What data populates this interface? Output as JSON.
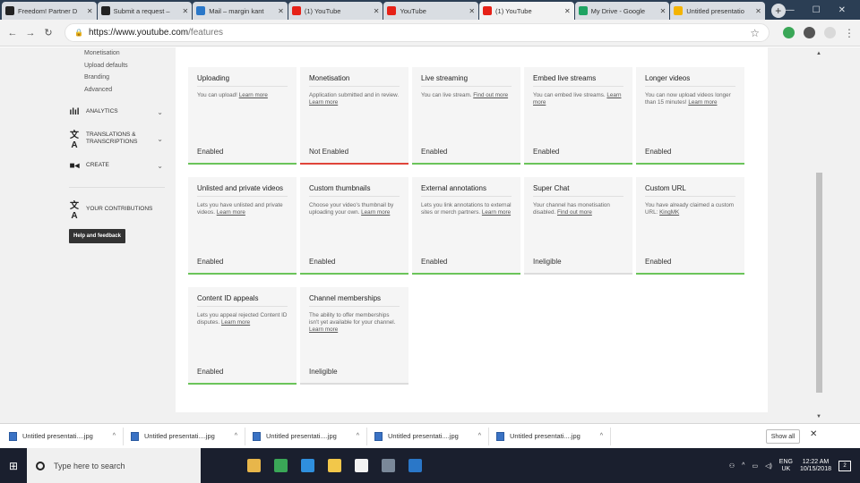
{
  "browser": {
    "tabs": [
      {
        "label": "Freedom! Partner D",
        "color": "#222222",
        "active": false
      },
      {
        "label": "Submit a request –",
        "color": "#222222",
        "active": false
      },
      {
        "label": "Mail – margin kant",
        "color": "#2a77c8",
        "active": false
      },
      {
        "label": "(1) YouTube",
        "color": "#e62117",
        "active": false
      },
      {
        "label": "YouTube",
        "color": "#e62117",
        "active": false
      },
      {
        "label": "(1) YouTube",
        "color": "#e62117",
        "active": true
      },
      {
        "label": "My Drive - Google",
        "color": "#1ea362",
        "active": false
      },
      {
        "label": "Untitled presentatio",
        "color": "#f4b400",
        "active": false
      }
    ],
    "new_tab": "+",
    "url_base": "https://www.youtube.com",
    "url_path": "/features"
  },
  "sidebar": {
    "sub_items": [
      "Monetisation",
      "Upload defaults",
      "Branding",
      "Advanced"
    ],
    "groups": [
      {
        "label": "ANALYTICS",
        "icon": "analytics-icon",
        "glyph": "ılıl"
      },
      {
        "label": "TRANSLATIONS & TRANSCRIPTIONS",
        "icon": "translate-icon",
        "glyph": "文A"
      },
      {
        "label": "CREATE",
        "icon": "create-icon",
        "glyph": "■◂"
      }
    ],
    "contributions": "YOUR CONTRIBUTIONS",
    "help_button": "Help and feedback"
  },
  "features": [
    {
      "title": "Uploading",
      "desc": "You can upload! ",
      "link": "Learn more",
      "status": "Enabled",
      "state": "ok"
    },
    {
      "title": "Monetisation",
      "desc": "Application submitted and in review. ",
      "link": "Learn more",
      "status": "Not Enabled",
      "state": "bad"
    },
    {
      "title": "Live streaming",
      "desc": "You can live stream. ",
      "link": "Find out more",
      "status": "Enabled",
      "state": "ok"
    },
    {
      "title": "Embed live streams",
      "desc": "You can embed live streams. ",
      "link": "Learn more",
      "status": "Enabled",
      "state": "ok"
    },
    {
      "title": "Longer videos",
      "desc": "You can now upload videos longer than 15 minutes! ",
      "link": "Learn more",
      "status": "Enabled",
      "state": "ok"
    },
    {
      "title": "Unlisted and private videos",
      "desc": "Lets you have unlisted and private videos. ",
      "link": "Learn more",
      "status": "Enabled",
      "state": "ok"
    },
    {
      "title": "Custom thumbnails",
      "desc": "Choose your video's thumbnail by uploading your own. ",
      "link": "Learn more",
      "status": "Enabled",
      "state": "ok"
    },
    {
      "title": "External annotations",
      "desc": "Lets you link annotations to external sites or merch partners. ",
      "link": "Learn more",
      "status": "Enabled",
      "state": "ok"
    },
    {
      "title": "Super Chat",
      "desc": "Your channel has monetisation disabled. ",
      "link": "Find out more",
      "status": "Ineligible",
      "state": "neutral"
    },
    {
      "title": "Custom URL",
      "desc": "You have already claimed a custom URL: ",
      "link": "KingMK",
      "status": "Enabled",
      "state": "ok"
    },
    {
      "title": "Content ID appeals",
      "desc": "Lets you appeal rejected Content ID disputes. ",
      "link": "Learn more",
      "status": "Enabled",
      "state": "ok"
    },
    {
      "title": "Channel memberships",
      "desc": "The ability to offer memberships isn't yet available for your channel. ",
      "link": "Learn more",
      "status": "Ineligible",
      "state": "neutral"
    }
  ],
  "status_colors": {
    "ok": "#6bc45a",
    "bad": "#e0453a",
    "neutral": "#dcdcdc"
  },
  "downloads": {
    "items": [
      "Untitled presentati....jpg",
      "Untitled presentati....jpg",
      "Untitled presentati....jpg",
      "Untitled presentati....jpg",
      "Untitled presentati....jpg"
    ],
    "show_all": "Show all",
    "close": "✕"
  },
  "taskbar": {
    "search_placeholder": "Type here to search",
    "apps": [
      {
        "name": "mic-icon",
        "color": "#1a1f2e"
      },
      {
        "name": "paint-icon",
        "color": "#e8b64a"
      },
      {
        "name": "chrome-icon",
        "color": "#3aa757"
      },
      {
        "name": "edge-icon",
        "color": "#2f8fde"
      },
      {
        "name": "explorer-icon",
        "color": "#f2c74a"
      },
      {
        "name": "store-icon",
        "color": "#f2f2f2"
      },
      {
        "name": "terminal-icon",
        "color": "#7a8899"
      },
      {
        "name": "photos-icon",
        "color": "#2a77c8"
      }
    ],
    "lang_top": "ENG",
    "lang_bottom": "UK",
    "time": "12:22 AM",
    "date": "10/15/2018",
    "notifications": "2"
  }
}
